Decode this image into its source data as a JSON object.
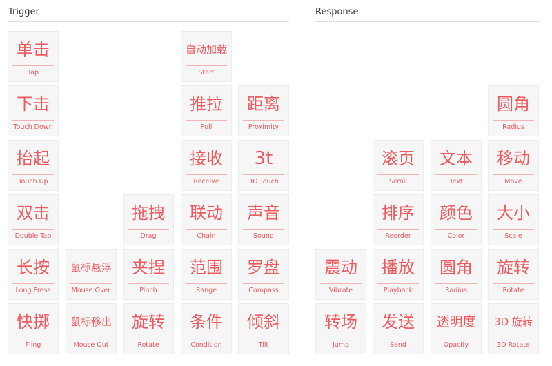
{
  "trigger": {
    "title": "Trigger",
    "tiles": [
      {
        "zh": "单击",
        "en": "Tap"
      },
      {
        "zh": "自动加载",
        "en": "Start"
      },
      {
        "zh": "下击",
        "en": "Touch Down"
      },
      {
        "zh": "推拉",
        "en": "Pull"
      },
      {
        "zh": "距离",
        "en": "Proximity"
      },
      {
        "zh": "抬起",
        "en": "Touch Up"
      },
      {
        "zh": "接收",
        "en": "Receive"
      },
      {
        "zh": "3t",
        "en": "3D Touch"
      },
      {
        "zh": "双击",
        "en": "Double Tap"
      },
      {
        "zh": "拖拽",
        "en": "Drag"
      },
      {
        "zh": "联动",
        "en": "Chain"
      },
      {
        "zh": "声音",
        "en": "Sound"
      },
      {
        "zh": "长按",
        "en": "Long Press"
      },
      {
        "zh": "鼠标悬浮",
        "en": "Mouse Over"
      },
      {
        "zh": "夹捏",
        "en": "Pinch"
      },
      {
        "zh": "范围",
        "en": "Range"
      },
      {
        "zh": "罗盘",
        "en": "Compass"
      },
      {
        "zh": "快掷",
        "en": "Fling"
      },
      {
        "zh": "鼠标移出",
        "en": "Mouse Out"
      },
      {
        "zh": "旋转",
        "en": "Rotate"
      },
      {
        "zh": "条件",
        "en": "Condition"
      },
      {
        "zh": "倾斜",
        "en": "Tilt"
      }
    ]
  },
  "response": {
    "title": "Response",
    "tiles": [
      {
        "zh": "圆角",
        "en": "Radius"
      },
      {
        "zh": "滚页",
        "en": "Scroll"
      },
      {
        "zh": "文本",
        "en": "Text"
      },
      {
        "zh": "移动",
        "en": "Move"
      },
      {
        "zh": "排序",
        "en": "Reorder"
      },
      {
        "zh": "颜色",
        "en": "Color"
      },
      {
        "zh": "大小",
        "en": "Scale"
      },
      {
        "zh": "震动",
        "en": "Vibrate"
      },
      {
        "zh": "播放",
        "en": "Playback"
      },
      {
        "zh": "圆角",
        "en": "Radius"
      },
      {
        "zh": "旋转",
        "en": "Rotate"
      },
      {
        "zh": "转场",
        "en": "Jump"
      },
      {
        "zh": "发送",
        "en": "Send"
      },
      {
        "zh": "透明度",
        "en": "Opacity"
      },
      {
        "zh": "3D 旋转",
        "en": "3D Rotate"
      }
    ]
  },
  "theme": {
    "accent": "#ee5a5e",
    "tile_bg": "#f6f6f6",
    "rule": "#e2e2e2"
  }
}
